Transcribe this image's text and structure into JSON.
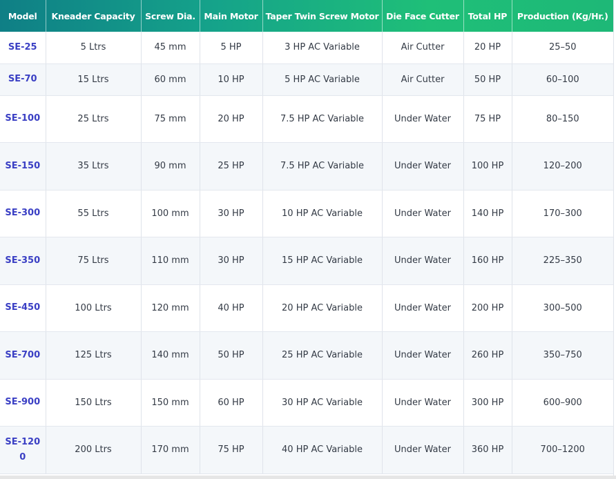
{
  "table": {
    "headers": [
      "Model",
      "Kneader Capacity",
      "Screw Dia.",
      "Main Motor",
      "Taper Twin Screw Motor",
      "Die Face Cutter",
      "Total HP",
      "Production (Kg/Hr.)"
    ],
    "rows": [
      {
        "model": "SE-25",
        "cells": [
          "5 Ltrs",
          "45 mm",
          "5 HP",
          "3 HP AC Variable",
          "Air Cutter",
          "20 HP",
          "25–50"
        ]
      },
      {
        "model": "SE-70",
        "cells": [
          "15 Ltrs",
          "60 mm",
          "10 HP",
          "5 HP AC Variable",
          "Air Cutter",
          "50 HP",
          "60–100"
        ]
      },
      {
        "model": "SE-100",
        "cells": [
          "25 Ltrs",
          "75 mm",
          "20 HP",
          "7.5 HP AC Variable",
          "Under Water",
          "75 HP",
          "80–150"
        ]
      },
      {
        "model": "SE-150",
        "cells": [
          "35 Ltrs",
          "90 mm",
          "25 HP",
          "7.5 HP AC Variable",
          "Under Water",
          "100 HP",
          "120–200"
        ]
      },
      {
        "model": "SE-300",
        "cells": [
          "55 Ltrs",
          "100 mm",
          "30 HP",
          "10 HP AC Variable",
          "Under Water",
          "140 HP",
          "170–300"
        ]
      },
      {
        "model": "SE-350",
        "cells": [
          "75 Ltrs",
          "110 mm",
          "30 HP",
          "15 HP AC Variable",
          "Under Water",
          "160 HP",
          "225–350"
        ]
      },
      {
        "model": "SE-450",
        "cells": [
          "100 Ltrs",
          "120 mm",
          "40 HP",
          "20 HP AC Variable",
          "Under Water",
          "200 HP",
          "300–500"
        ]
      },
      {
        "model": "SE-700",
        "cells": [
          "125 Ltrs",
          "140 mm",
          "50 HP",
          "25 HP AC Variable",
          "Under Water",
          "260 HP",
          "350–750"
        ]
      },
      {
        "model": "SE-900",
        "cells": [
          "150 Ltrs",
          "150 mm",
          "60 HP",
          "30 HP AC Variable",
          "Under Water",
          "300 HP",
          "600–900"
        ]
      },
      {
        "model": "SE-1200",
        "cells": [
          "200 Ltrs",
          "170 mm",
          "75 HP",
          "40 HP AC Variable",
          "Under Water",
          "360 HP",
          "700–1200"
        ]
      }
    ]
  },
  "colors": {
    "header_gradient_start": "#0f7f86",
    "header_gradient_end": "#1eb877",
    "model_text": "#3a3fc4",
    "body_text": "#333a45",
    "row_alt": "#f4f7fa"
  }
}
